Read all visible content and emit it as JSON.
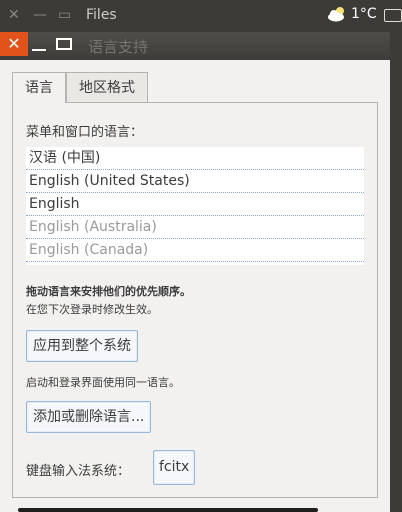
{
  "top_panel": {
    "app_title": "Files",
    "close_glyph": "✕",
    "min_glyph": "—",
    "max_glyph": "▭",
    "weather_icon": "cloud-sun-icon",
    "temperature": "1°C",
    "keyboard_icon": "keyboard-icon"
  },
  "dialog": {
    "title": "语言支持",
    "close_glyph": "✕"
  },
  "tabs": [
    {
      "label": "语言"
    },
    {
      "label": "地区格式"
    }
  ],
  "language_tab": {
    "list_label": "菜单和窗口的语言：",
    "languages": [
      {
        "label": "汉语 (中国)"
      },
      {
        "label": "English (United States)"
      },
      {
        "label": "English"
      },
      {
        "label": "English (Australia)"
      },
      {
        "label": "English (Canada)"
      }
    ],
    "hint_bold": "拖动语言来安排他们的优先顺序。",
    "hint_next_login": "在您下次登录时修改生效。",
    "apply_button": "应用到整个系统",
    "apply_hint": "启动和登录界面使用同一语言。",
    "add_remove_button": "添加或删除语言...",
    "input_method_label": "键盘输入法系统：",
    "input_method_value": "fcitx"
  }
}
